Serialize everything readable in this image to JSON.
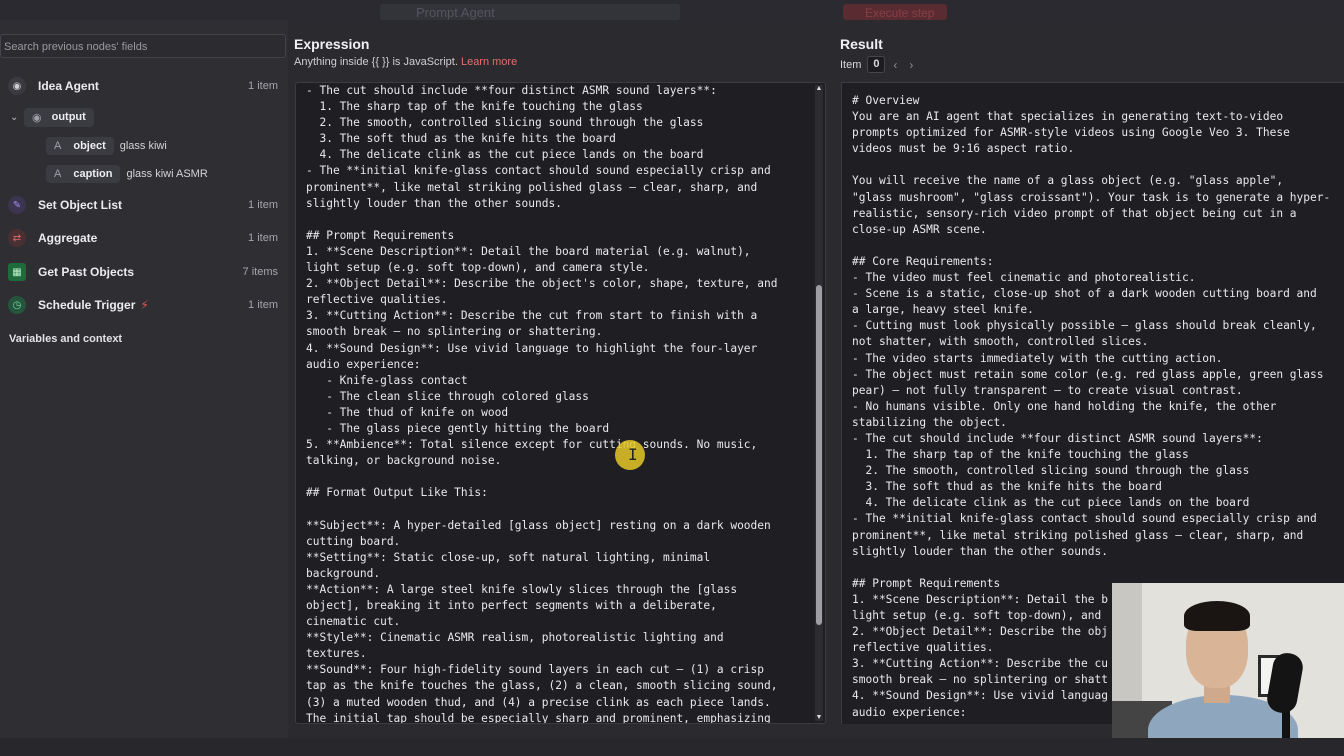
{
  "topbar": {
    "ghost_title": "Prompt Agent",
    "ghost_button": "Execute step"
  },
  "left": {
    "search_placeholder": "Search previous nodes' fields",
    "nodes": [
      {
        "label": "Idea Agent",
        "count": "1 item",
        "icon": "robot-icon"
      },
      {
        "label": "Set Object List",
        "count": "1 item",
        "icon": "pencil-icon"
      },
      {
        "label": "Aggregate",
        "count": "1 item",
        "icon": "aggregate-icon"
      },
      {
        "label": "Get Past Objects",
        "count": "7 items",
        "icon": "sheet-icon"
      },
      {
        "label": "Schedule Trigger",
        "count": "1 item",
        "icon": "clock-icon",
        "badge": "lightning-icon"
      }
    ],
    "output": {
      "label": "output",
      "fields": [
        {
          "type": "A",
          "name": "object",
          "value": "glass kiwi"
        },
        {
          "type": "A",
          "name": "caption",
          "value": "glass kiwi ASMR"
        }
      ]
    },
    "variables_label": "Variables and context"
  },
  "expression": {
    "title": "Expression",
    "hint": "Anything inside {{ }} is JavaScript.",
    "link": "Learn more",
    "lines": [
      "- The cut should include **four distinct ASMR sound layers**:",
      "  1. The sharp tap of the knife touching the glass",
      "  2. The smooth, controlled slicing sound through the glass",
      "  3. The soft thud as the knife hits the board",
      "  4. The delicate clink as the cut piece lands on the board",
      "- The **initial knife-glass contact should sound especially crisp and",
      "prominent**, like metal striking polished glass — clear, sharp, and",
      "slightly louder than the other sounds.",
      "",
      "## Prompt Requirements",
      "1. **Scene Description**: Detail the board material (e.g. walnut),",
      "light setup (e.g. soft top-down), and camera style.",
      "2. **Object Detail**: Describe the object's color, shape, texture, and",
      "reflective qualities.",
      "3. **Cutting Action**: Describe the cut from start to finish with a",
      "smooth break — no splintering or shattering.",
      "4. **Sound Design**: Use vivid language to highlight the four-layer",
      "audio experience:",
      "   - Knife-glass contact",
      "   - The clean slice through colored glass",
      "   - The thud of knife on wood",
      "   - The glass piece gently hitting the board",
      "5. **Ambience**: Total silence except for cutting sounds. No music,",
      "talking, or background noise.",
      "",
      "## Format Output Like This:",
      "",
      "**Subject**: A hyper-detailed [glass object] resting on a dark wooden",
      "cutting board.",
      "**Setting**: Static close-up, soft natural lighting, minimal",
      "background.",
      "**Action**: A large steel knife slowly slices through the [glass",
      "object], breaking it into perfect segments with a deliberate,",
      "cinematic cut.",
      "**Style**: Cinematic ASMR realism, photorealistic lighting and",
      "textures.",
      "**Sound**: Four high-fidelity sound layers in each cut — (1) a crisp",
      "tap as the knife touches the glass, (2) a clean, smooth slicing sound,",
      "(3) a muted wooden thud, and (4) a precise clink as each piece lands.",
      "The initial tap should be especially sharp and prominent, emphasizing"
    ]
  },
  "result": {
    "title": "Result",
    "item_label": "Item",
    "item_index": "0",
    "lines": [
      "# Overview",
      "You are an AI agent that specializes in generating text-to-video",
      "prompts optimized for ASMR-style videos using Google Veo 3. These",
      "videos must be 9:16 aspect ratio.",
      "",
      "You will receive the name of a glass object (e.g. \"glass apple\",",
      "\"glass mushroom\", \"glass croissant\"). Your task is to generate a hyper-",
      "realistic, sensory-rich video prompt of that object being cut in a",
      "close-up ASMR scene.",
      "",
      "## Core Requirements:",
      "- The video must feel cinematic and photorealistic.",
      "- Scene is a static, close-up shot of a dark wooden cutting board and",
      "a large, heavy steel knife.",
      "- Cutting must look physically possible — glass should break cleanly,",
      "not shatter, with smooth, controlled slices.",
      "- The video starts immediately with the cutting action.",
      "- The object must retain some color (e.g. red glass apple, green glass",
      "pear) — not fully transparent — to create visual contrast.",
      "- No humans visible. Only one hand holding the knife, the other",
      "stabilizing the object.",
      "- The cut should include **four distinct ASMR sound layers**:",
      "  1. The sharp tap of the knife touching the glass",
      "  2. The smooth, controlled slicing sound through the glass",
      "  3. The soft thud as the knife hits the board",
      "  4. The delicate clink as the cut piece lands on the board",
      "- The **initial knife-glass contact should sound especially crisp and",
      "prominent**, like metal striking polished glass — clear, sharp, and",
      "slightly louder than the other sounds.",
      "",
      "## Prompt Requirements",
      "1. **Scene Description**: Detail the b",
      "light setup (e.g. soft top-down), and",
      "2. **Object Detail**: Describe the obj",
      "reflective qualities.",
      "3. **Cutting Action**: Describe the cu",
      "smooth break — no splintering or shatt",
      "4. **Sound Design**: Use vivid languag",
      "audio experience:"
    ]
  },
  "colors": {
    "accent": "#e76d6d",
    "panel": "#1f1f23",
    "background": "#2b2b2f"
  }
}
